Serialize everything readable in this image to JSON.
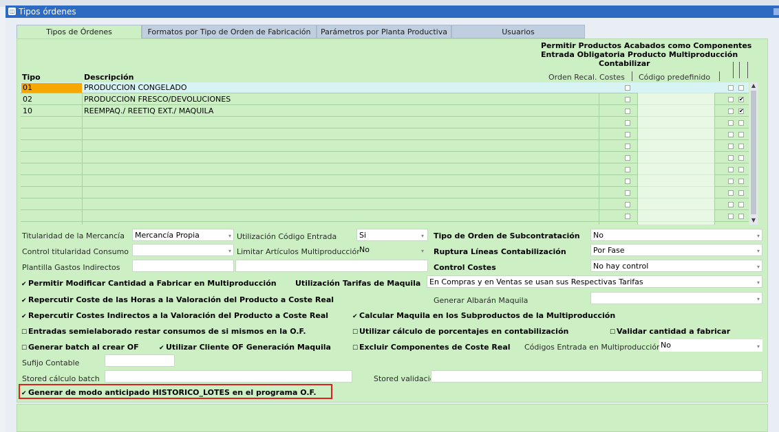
{
  "window": {
    "title": "Tipos órdenes"
  },
  "tabs": [
    {
      "label": "Tipos de Órdenes",
      "active": true
    },
    {
      "label": "Formatos por Tipo de Orden de Fabricación"
    },
    {
      "label": "Parámetros por Planta Productiva"
    },
    {
      "label": "Usuarios"
    }
  ],
  "grid": {
    "headers": {
      "tipo": "Tipo",
      "descripcion": "Descripción",
      "orden_recal": "Orden Recal. Costes",
      "codigo_pred": "Código predefinido",
      "permitir": "Permitir Productos Acabados como Componentes",
      "entrada": "Entrada Obligatoria Producto Multiproducción",
      "contabilizar": "Contabilizar"
    },
    "rows": [
      {
        "tipo": "01",
        "descripcion": "PRODUCCION CONGELADO",
        "c1": "",
        "c2": ""
      },
      {
        "tipo": "02",
        "descripcion": "PRODUCCION FRESCO/DEVOLUCIONES",
        "c1": "",
        "c2": "✔"
      },
      {
        "tipo": "10",
        "descripcion": "REEMPAQ./ REETIQ EXT./ MAQUILA",
        "c1": "",
        "c2": "✔"
      }
    ]
  },
  "form": {
    "titularidad_label": "Titularidad de la Mercancía",
    "titularidad_value": "Mercancía Propia",
    "util_codigo_label": "Utilización Código Entrada",
    "util_codigo_value": "Si",
    "tipo_subcontratacion_label": "Tipo de Orden de Subcontratación",
    "tipo_subcontratacion_value": "No",
    "control_titularidad_label": "Control titularidad Consumo",
    "limitar_label": "Limitar Artículos Multiproducción",
    "limitar_value": "No",
    "ruptura_label": "Ruptura Líneas Contabilización",
    "ruptura_value": "Por Fase",
    "plantilla_label": "Plantilla Gastos Indirectos",
    "control_costes_label": "Control Costes",
    "control_costes_value": "No hay control",
    "permitir_modificar": "Permitir Modificar Cantidad a Fabricar en Multiproducción",
    "util_tarifas_label": "Utilización Tarifas de Maquila",
    "util_tarifas_value": "En Compras y en Ventas se usan sus Respectivas Tarifas",
    "repercutir_horas": "Repercutir Coste de las Horas a la Valoración del Producto a Coste Real",
    "generar_albaran_label": "Generar Albarán Maquila",
    "repercutir_indirectos": "Repercutir Costes Indirectos a la Valoración del Producto a Coste Real",
    "calcular_maquila": "Calcular Maquila en los Subproductos de la Multiproducción",
    "entradas_semi": "Entradas semielaborado restar consumos de si mismos en la O.F.",
    "utilizar_porcentajes": "Utilizar cálculo de porcentajes en contabilización",
    "validar_cantidad": "Validar cantidad a fabricar",
    "generar_batch": "Generar batch al crear OF",
    "utilizar_cliente": "Utilizar Cliente OF Generación Maquila",
    "excluir_componentes": "Excluir Componentes de Coste Real",
    "codigos_entrada_label": "Códigos Entrada en Multiproducción",
    "codigos_entrada_value": "No",
    "sufijo_label": "Sufijo Contable",
    "stored_batch_label": "Stored cálculo batch",
    "stored_validacion_label": "Stored validación",
    "generar_historico": "Generar de modo anticipado HISTORICO_LOTES en el programa O.F."
  },
  "colors": {
    "panel": "#ccf0c4",
    "titlebar": "#2d6ac2",
    "selected": "#f7a800",
    "highlight": "#e02020"
  }
}
